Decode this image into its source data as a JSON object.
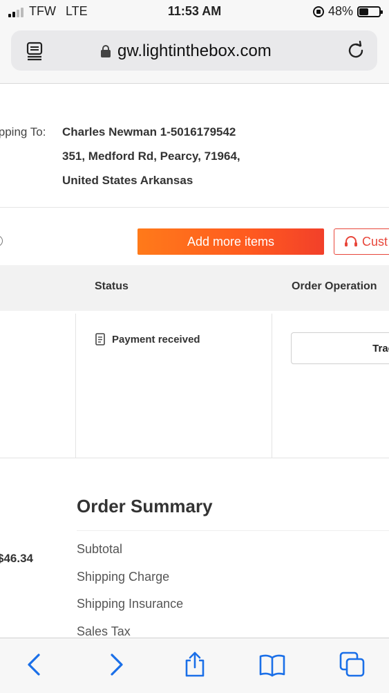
{
  "status_bar": {
    "carrier": "TFW",
    "network": "LTE",
    "time": "11:53 AM",
    "battery_text": "48%",
    "battery_level": 0.48
  },
  "browser": {
    "url": "gw.lightinthebox.com",
    "reader_icon": "reader-mode-icon",
    "reload_icon": "reload-icon",
    "toolbar": {
      "back_icon": "chevron-left-icon",
      "forward_icon": "chevron-right-icon",
      "share_icon": "share-icon",
      "bookmarks_icon": "book-icon",
      "tabs_icon": "tabs-icon"
    }
  },
  "shipping": {
    "label": "ipping To:",
    "line1": "Charles Newman 1-5016179542",
    "line2": "351, Medford Rd, Pearcy, 71964,",
    "line3": "United States Arkansas"
  },
  "actions": {
    "add_more_items": "Add more items",
    "customer_service": "Cust"
  },
  "order_table": {
    "headers": {
      "status": "Status",
      "operation": "Order Operation"
    },
    "row": {
      "status": "Payment received",
      "operation_button": "Trac"
    }
  },
  "order_summary": {
    "title": "Order Summary",
    "price": "$46.34",
    "lines": [
      "Subtotal",
      "Shipping Charge",
      "Shipping Insurance",
      "Sales Tax"
    ]
  },
  "colors": {
    "accent_gradient_start": "#ff7a1a",
    "accent_gradient_end": "#f2402a",
    "customer_service_red": "#e8463a",
    "ios_blue": "#1a6fe8"
  }
}
